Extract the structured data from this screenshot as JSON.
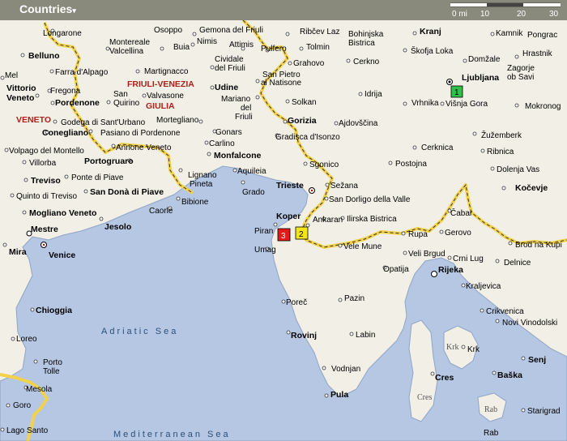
{
  "topbar": {
    "countries_label": "Countries"
  },
  "scale": {
    "unit": "0 mi",
    "t10": "10",
    "t20": "20",
    "t30": "30"
  },
  "seas": {
    "adriatic": "Adriatic Sea",
    "mediterranean": "Mediterranean Sea"
  },
  "regions": {
    "friuli1": "FRIULI-VENEZIA",
    "friuli2": "GIULIA",
    "veneto": "VENETO"
  },
  "markers": {
    "m1": "1",
    "m2": "2",
    "m3": "3"
  },
  "places": {
    "lungarone": "Longarone",
    "osoppo": "Osoppo",
    "gemona": "Gemona del Friuli",
    "ribcev": "Ribčev Laz",
    "kranj": "Kranj",
    "kamnik": "Kamnik",
    "pongrac": "Pongrac",
    "bohinj1": "Bohinjska",
    "bohinj2": "Bistrica",
    "montereale1": "Montereale",
    "montereale2": "Valcellina",
    "buia": "Buia",
    "nimis": "Nimis",
    "attimis": "Attimis",
    "pulfero": "Pulfero",
    "tolmin": "Tolmin",
    "skofja": "Škofja Loka",
    "domzale": "Domžale",
    "hrastnik": "Hrastnik",
    "zagorje1": "Zagorje",
    "zagorje2": "ob Savi",
    "belluno": "Belluno",
    "farra": "Farra d'Alpago",
    "cividale1": "Cividale",
    "cividale2": "del Friuli",
    "grahovo": "Grahovo",
    "cerkno": "Cerkno",
    "mel": "Mel",
    "martignacco": "Martignacco",
    "sanpietro1": "San Pietro",
    "sanpietro2": "al Natisone",
    "ljubljana": "Ljubljana",
    "vittorio1": "Vittorio",
    "vittorio2": "Veneto",
    "fregona": "Fregona",
    "udine": "Udine",
    "idrija": "Idrija",
    "vrhnika": "Vrhnika",
    "visnja": "Višnja Gora",
    "mokronog": "Mokronog",
    "pordenone": "Pordenone",
    "sanquirino1": "San",
    "sanquirino2": "Quirino",
    "valvasone": "Valvasone",
    "mariano1": "Mariano",
    "mariano2": "del",
    "mariano3": "Friuli",
    "solkan": "Solkan",
    "conegliano": "Conegliano",
    "godega": "Godega di Sant'Urbano",
    "mortegliano": "Mortegliano",
    "gorizia": "Gorizia",
    "ajdovscina": "Ajdovščina",
    "zuzemberk": "Žužemberk",
    "pasiano": "Pasiano di Pordenone",
    "gonars": "Gonars",
    "gradisca": "Gradisca d'Isonzo",
    "volpago": "Volpago del Montello",
    "annone": "Annone Veneto",
    "carlino": "Carlino",
    "cerknica": "Cerknica",
    "ribnica": "Ribnica",
    "monfalcone": "Monfalcone",
    "sgonico": "Sgonico",
    "villorba": "Villorba",
    "portogruaro": "Portogruaro",
    "aquileia": "Aquileia",
    "postojna": "Postojna",
    "dolenja": "Dolenja Vas",
    "lignano1": "Lignano",
    "lignano2": "Pineta",
    "sezana": "Sežana",
    "treviso": "Treviso",
    "pontepiave": "Ponte di Piave",
    "trieste": "Trieste",
    "kocevje": "Kočevje",
    "grado": "Grado",
    "quinto": "Quinto di Treviso",
    "sandona": "San Donà di Piave",
    "bibione": "Bibione",
    "sandorligo": "San Dorligo della Valle",
    "mogliano": "Mogliano Veneto",
    "caorle": "Caorle",
    "cabar": "Čabar",
    "koper": "Koper",
    "ankaran": "Ankaran",
    "ilirska": "Ilirska Bistrica",
    "jesolo": "Jesolo",
    "mestre": "Mestre",
    "piran": "Piran",
    "rupa": "Rupa",
    "gerovo": "Gerovo",
    "brod": "Brod na Kupi",
    "mira": "Mira",
    "venice": "Venice",
    "velemune": "Vele Mune",
    "umag": "Umag",
    "velibrgud": "Veli Brgud",
    "crnilug": "Crni Lug",
    "delnice": "Delnice",
    "opatija": "Opatija",
    "rijeka": "Rijeka",
    "kraljevica": "Kraljevica",
    "chioggia": "Chioggia",
    "porec": "Poreč",
    "pazin": "Pazin",
    "crikvenica": "Crikvenica",
    "novi": "Novi Vinodolski",
    "loreo": "Loreo",
    "rovinj": "Rovinj",
    "labin": "Labin",
    "senj": "Senj",
    "porto1": "Porto",
    "porto2": "Tolle",
    "vodnjan": "Vodnjan",
    "cres": "Cres",
    "baska": "Baška",
    "mesola": "Mesola",
    "pula": "Pula",
    "goro": "Goro",
    "starigrad": "Starigrad",
    "lagosanto": "Lago Santo"
  },
  "islands": {
    "krk": "Krk",
    "krk_town": "Krk",
    "cres_i": "Cres",
    "rab": "Rab",
    "rab_town": "Rab"
  }
}
